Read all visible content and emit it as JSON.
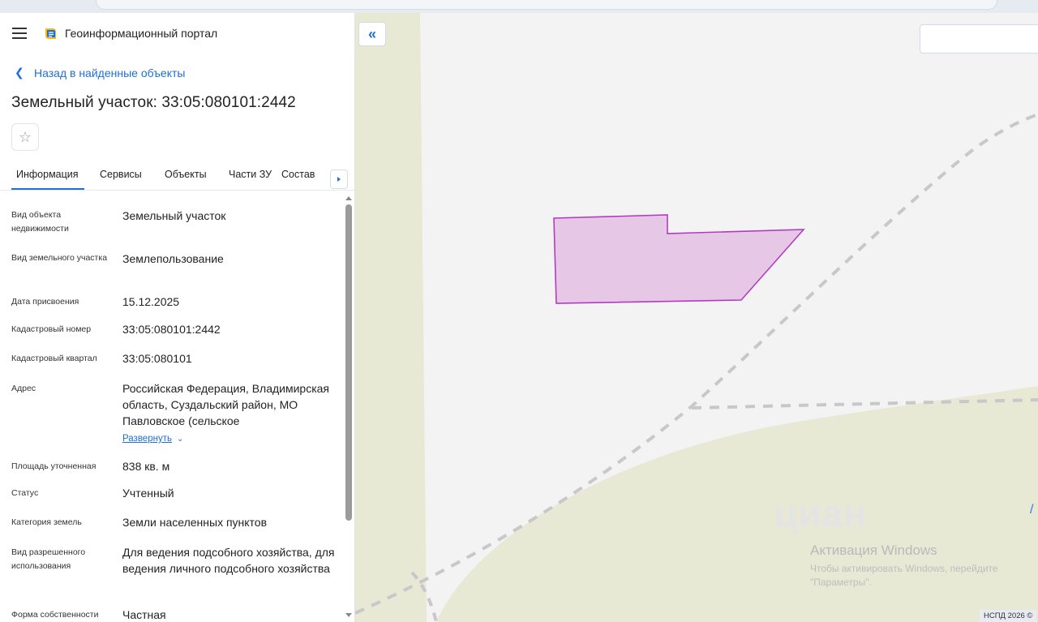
{
  "header": {
    "app_title": "Геоинформационный портал",
    "menu_icon": "hamburger-icon",
    "logo_icon": "portal-logo-icon"
  },
  "nav": {
    "back_label": "Назад в найденные объекты"
  },
  "object": {
    "title": "Земельный участок: 33:05:080101:2442"
  },
  "tabs": [
    {
      "label": "Информация",
      "active": true
    },
    {
      "label": "Сервисы",
      "active": false
    },
    {
      "label": "Объекты",
      "active": false
    },
    {
      "label": "Части ЗУ",
      "active": false
    },
    {
      "label": "Состав",
      "active": false
    }
  ],
  "properties": [
    {
      "label": "Вид объекта недвижимости",
      "value": "Земельный участок"
    },
    {
      "label": "Вид земельного участка",
      "value": "Землепользование"
    },
    {
      "label": "Дата присвоения",
      "value": "15.12.2025"
    },
    {
      "label": "Кадастровый номер",
      "value": "33:05:080101:2442"
    },
    {
      "label": "Кадастровый квартал",
      "value": "33:05:080101"
    },
    {
      "label": "Адрес",
      "value": "Российская Федерация, Владимирская область, Суздальский район, МО Павловское (сельское",
      "expand_label": "Развернуть"
    },
    {
      "label": "Площадь уточненная",
      "value": "838 кв. м"
    },
    {
      "label": "Статус",
      "value": "Учтенный"
    },
    {
      "label": "Категория земель",
      "value": "Земли населенных пунктов"
    },
    {
      "label": "Вид разрешенного использования",
      "value": "Для ведения подсобного хозяйства, для ведения личного подсобного хозяйства"
    },
    {
      "label": "Форма собственности",
      "value": "Частная"
    }
  ],
  "map": {
    "parcel_fill": "#e6c8e6",
    "parcel_stroke": "#b43bc0",
    "watermark_text": "циан",
    "attribution": "НСПД 2026 ©"
  },
  "windows_activation": {
    "title": "Активация Windows",
    "subtitle": "Чтобы активировать Windows, перейдите \"Параметры\"."
  },
  "colors": {
    "accent": "#1f6fd6"
  }
}
